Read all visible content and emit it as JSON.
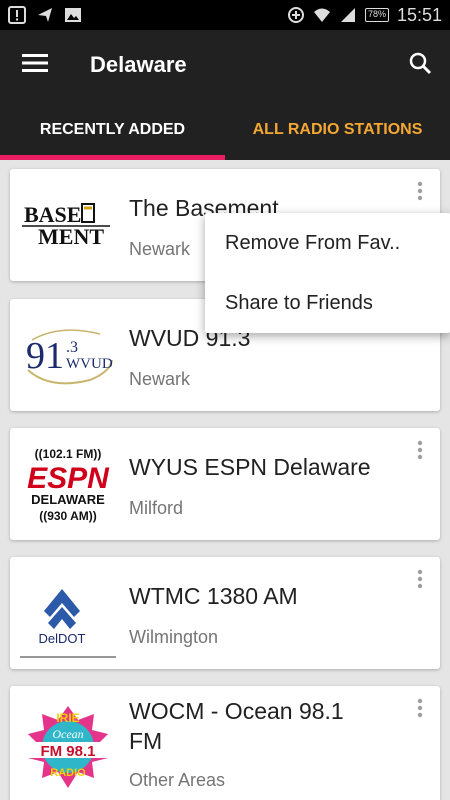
{
  "status_bar": {
    "icons": [
      "alert-icon",
      "no-signal-icon",
      "image-icon",
      "data-saver-icon",
      "wifi-icon",
      "signal-icon"
    ],
    "battery": "78%",
    "time": "15:51"
  },
  "app_bar": {
    "title": "Delaware",
    "menu_icon": "hamburger-icon",
    "search_icon": "search-icon"
  },
  "tabs": [
    {
      "label": "RECENTLY ADDED",
      "active": true
    },
    {
      "label": "ALL RADIO STATIONS",
      "active": false
    }
  ],
  "accent_colors": {
    "tab_indicator": "#e91e63",
    "inactive_tab": "#f4a833",
    "app_bar": "#212121"
  },
  "stations": [
    {
      "name": "The Basement",
      "location": "Newark",
      "logo": "basement-logo"
    },
    {
      "name": "WVUD 91.3",
      "location": "Newark",
      "logo": "wvud-logo"
    },
    {
      "name": "WYUS ESPN Delaware",
      "location": "Milford",
      "logo": "espn-delaware-logo"
    },
    {
      "name": "WTMC 1380 AM",
      "location": "Wilmington",
      "logo": "deldot-logo"
    },
    {
      "name": "WOCM - Ocean 98.1 FM",
      "location": "Other Areas",
      "logo": "irie-ocean-logo"
    }
  ],
  "logos": {
    "basement": {
      "line1": "BASE",
      "line2": "MENT"
    },
    "wvud": {
      "freq": "91",
      "decimal": ".3",
      "call": "WVUD"
    },
    "espn": {
      "top": "((102.1 FM))",
      "brand": "ESPN",
      "region": "DELAWARE",
      "bottom": "((930 AM))"
    },
    "deldot": {
      "text": "DelDOT"
    },
    "ocean": {
      "top": "IRIE",
      "mid": "Ocean",
      "freq": "FM 98.1",
      "bottom": "RADIO"
    }
  },
  "popup_menu": {
    "items": [
      "Remove From Fav..",
      "Share to Friends"
    ]
  }
}
